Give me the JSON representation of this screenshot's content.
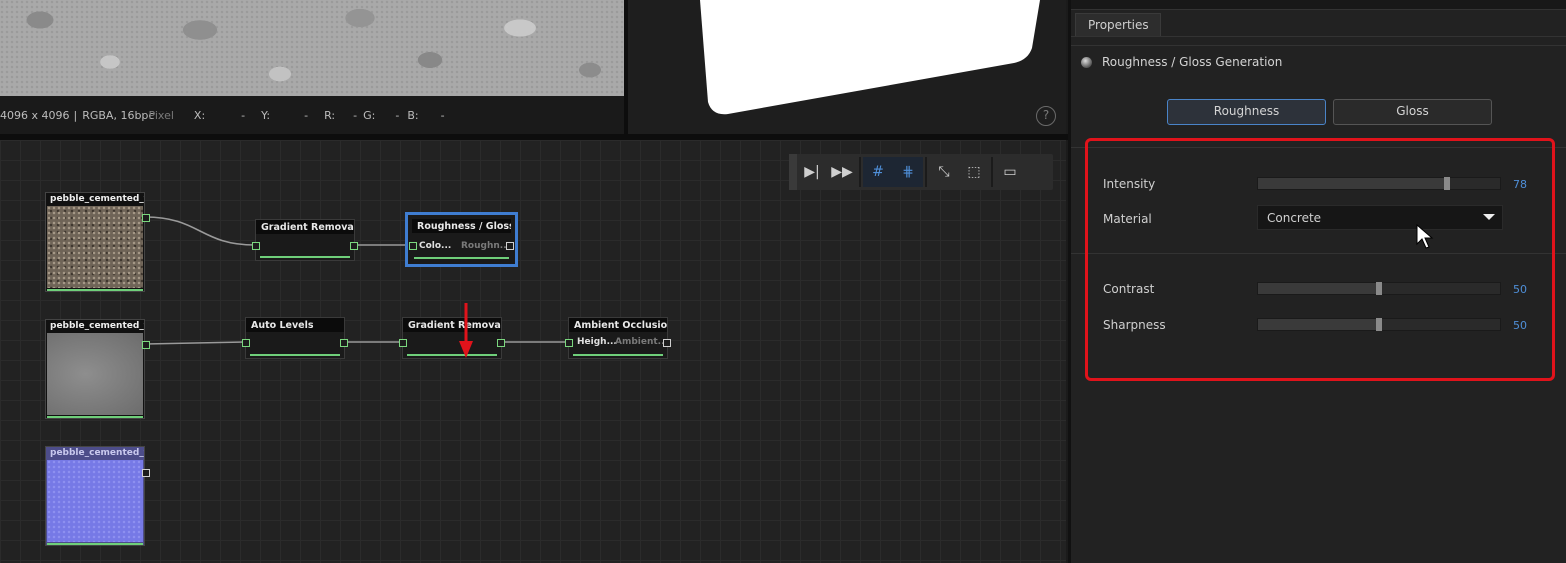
{
  "viewport2d": {
    "size": "4096 x 4096",
    "sep": "|",
    "format": "RGBA, 16bpc",
    "pixel_label": "Pixel",
    "x_label": "X:",
    "x_val": "-",
    "y_label": "Y:",
    "y_val": "-",
    "r_label": "R:",
    "r_val": "-",
    "g_label": "G:",
    "g_val": "-",
    "b_label": "B:",
    "b_val": "-"
  },
  "viewport3d": {
    "help_glyph": "?"
  },
  "graph": {
    "toolbar": [
      "step-icon",
      "fast-forward-icon",
      "grid-icon",
      "snap-grid-icon",
      "collapse-icon",
      "frame-icon",
      "add-frame-icon"
    ],
    "inputs": [
      {
        "name": "pebble_cemented_flo"
      },
      {
        "name": "pebble_cemented_flo"
      },
      {
        "name": "pebble_cemented_flo"
      }
    ],
    "nodes": {
      "gradient_removal_1": "Gradient Removal",
      "roughness_gloss": "Roughness / Gloss...",
      "roughness_in": "Colo...",
      "roughness_out": "Roughn...",
      "auto_levels": "Auto Levels",
      "gradient_removal_2": "Gradient Removal",
      "ambient_occlusion": "Ambient Occlusion...",
      "ao_in": "Heigh...",
      "ao_out": "Ambient..."
    }
  },
  "properties": {
    "tab_label": "Properties",
    "section_title": "Roughness / Gloss Generation",
    "mode_roughness": "Roughness",
    "mode_gloss": "Gloss",
    "mode_selected": "Roughness",
    "intensity_label": "Intensity",
    "intensity_value": "78",
    "intensity_fraction": 0.78,
    "material_label": "Material",
    "material_value": "Concrete",
    "contrast_label": "Contrast",
    "contrast_value": "50",
    "contrast_fraction": 0.5,
    "sharpness_label": "Sharpness",
    "sharpness_value": "50",
    "sharpness_fraction": 0.5
  },
  "annotation_colors": {
    "highlight": "#e0131b",
    "selection": "#3f7dd1",
    "accent": "#4f8fd8",
    "port": "#6fcf7a"
  }
}
